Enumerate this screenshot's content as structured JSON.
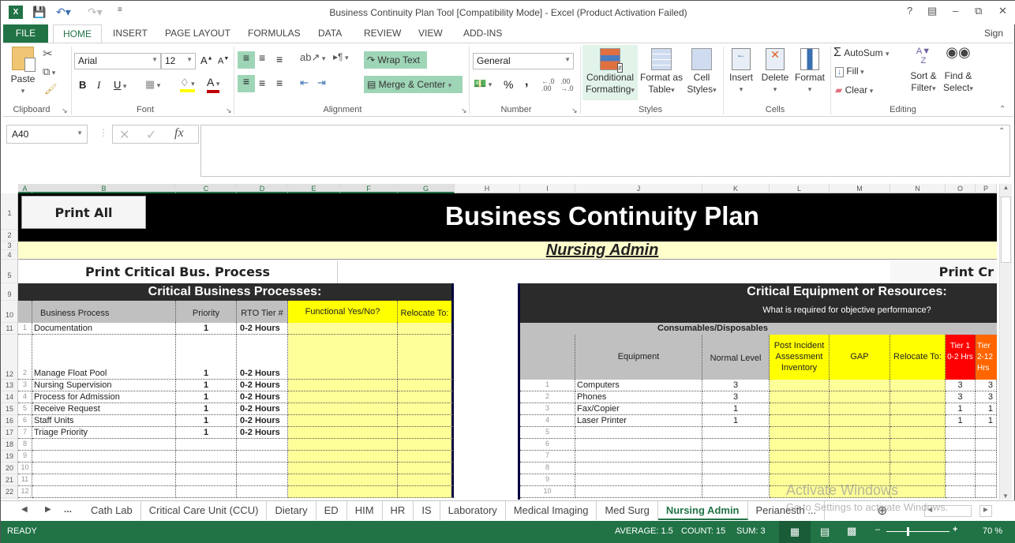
{
  "window": {
    "title": "Business Continuity Plan Tool  [Compatibility Mode] - Excel (Product Activation Failed)",
    "controls": [
      "?",
      "ribbon-display",
      "minimize",
      "restore",
      "close"
    ]
  },
  "ribbon_tabs": [
    "FILE",
    "HOME",
    "INSERT",
    "PAGE LAYOUT",
    "FORMULAS",
    "DATA",
    "REVIEW",
    "VIEW",
    "ADD-INS"
  ],
  "active_ribbon_tab": "HOME",
  "sign_in": "Sign in",
  "ribbon": {
    "clipboard": {
      "label": "Clipboard",
      "paste": "Paste"
    },
    "font": {
      "label": "Font",
      "family": "Arial",
      "size": "12",
      "bold": "B",
      "italic": "I",
      "underline": "U"
    },
    "alignment": {
      "label": "Alignment",
      "wrap_text": "Wrap Text",
      "merge_center": "Merge & Center"
    },
    "number": {
      "label": "Number",
      "format": "General",
      "percent": "%",
      "comma": ","
    },
    "styles": {
      "label": "Styles",
      "conditional_formatting": [
        "Conditional",
        "Formatting"
      ],
      "format_as_table": [
        "Format as",
        "Table"
      ],
      "cell_styles": [
        "Cell",
        "Styles"
      ]
    },
    "cells": {
      "label": "Cells",
      "insert": "Insert",
      "delete": "Delete",
      "format": "Format"
    },
    "editing": {
      "label": "Editing",
      "autosum": "AutoSum",
      "fill": "Fill",
      "clear": "Clear",
      "sort_filter": [
        "Sort &",
        "Filter"
      ],
      "find_select": [
        "Find &",
        "Select"
      ]
    }
  },
  "formula_bar": {
    "name_box": "A40",
    "formula": "",
    "fx": "fx"
  },
  "columns": [
    "A",
    "B",
    "C",
    "D",
    "E",
    "F",
    "G",
    "H",
    "I",
    "J",
    "K",
    "L",
    "M",
    "N",
    "O",
    "P"
  ],
  "rows": [
    "1",
    "2",
    "3",
    "4",
    "5",
    "9",
    "10",
    "11",
    "12",
    "13",
    "14",
    "15",
    "16",
    "17",
    "18",
    "19",
    "20",
    "21",
    "22"
  ],
  "sheet": {
    "print_all": "Print All",
    "title": "Business Continuity Plan",
    "department": "Nursing Admin",
    "print_critical": "Print Critical Bus. Process",
    "print_cr_partial": "Print Cr",
    "processes": {
      "heading": "Critical Business Processes:",
      "headers": [
        "Business Process",
        "Priority",
        "RTO Tier #",
        "Functional Yes/No?",
        "Relocate To:"
      ],
      "rows": [
        {
          "n": "1",
          "process": "Documentation",
          "priority": "1",
          "rto": "0-2 Hours"
        },
        {
          "n": "2",
          "process": "Manage Float Pool",
          "priority": "1",
          "rto": "0-2 Hours"
        },
        {
          "n": "3",
          "process": "Nursing Supervision",
          "priority": "1",
          "rto": "0-2 Hours"
        },
        {
          "n": "4",
          "process": "Process for Admission",
          "priority": "1",
          "rto": "0-2 Hours"
        },
        {
          "n": "5",
          "process": "Receive Request",
          "priority": "1",
          "rto": "0-2 Hours"
        },
        {
          "n": "6",
          "process": "Staff Units",
          "priority": "1",
          "rto": "0-2 Hours"
        },
        {
          "n": "7",
          "process": "Triage Priority",
          "priority": "1",
          "rto": "0-2 Hours"
        },
        {
          "n": "8",
          "process": "",
          "priority": "",
          "rto": ""
        },
        {
          "n": "9",
          "process": "",
          "priority": "",
          "rto": ""
        },
        {
          "n": "10",
          "process": "",
          "priority": "",
          "rto": ""
        },
        {
          "n": "11",
          "process": "",
          "priority": "",
          "rto": ""
        },
        {
          "n": "12",
          "process": "",
          "priority": "",
          "rto": ""
        }
      ]
    },
    "equipment": {
      "heading": "Critical Equipment or Resources:",
      "subheading": "What is required for objective performance?",
      "section": "Consumables/Disposables",
      "headers": [
        "Equipment",
        "Normal Level",
        "Post Incident Assessment Inventory",
        "GAP",
        "Relocate To:",
        "Tier 1 0-2 Hrs",
        "Tier 2-12 Hrs"
      ],
      "rows": [
        {
          "n": "1",
          "item": "Computers",
          "normal": "3",
          "t1": "3",
          "t2": "3"
        },
        {
          "n": "2",
          "item": "Phones",
          "normal": "3",
          "t1": "3",
          "t2": "3"
        },
        {
          "n": "3",
          "item": "Fax/Copier",
          "normal": "1",
          "t1": "1",
          "t2": "1"
        },
        {
          "n": "4",
          "item": "Laser Printer",
          "normal": "1",
          "t1": "1",
          "t2": "1"
        },
        {
          "n": "5",
          "item": "",
          "normal": "",
          "t1": "",
          "t2": ""
        },
        {
          "n": "6",
          "item": "",
          "normal": "",
          "t1": "",
          "t2": ""
        },
        {
          "n": "7",
          "item": "",
          "normal": "",
          "t1": "",
          "t2": ""
        },
        {
          "n": "8",
          "item": "",
          "normal": "",
          "t1": "",
          "t2": ""
        },
        {
          "n": "9",
          "item": "",
          "normal": "",
          "t1": "",
          "t2": ""
        },
        {
          "n": "10",
          "item": "",
          "normal": "",
          "t1": "",
          "t2": ""
        }
      ]
    }
  },
  "sheet_tabs": [
    "Cath Lab",
    "Critical Care Unit (CCU)",
    "Dietary",
    "ED",
    "HIM",
    "HR",
    "IS",
    "Laboratory",
    "Medical Imaging",
    "Med Surg",
    "Nursing Admin",
    "Perianesth ..."
  ],
  "active_sheet": "Nursing Admin",
  "watermark": {
    "line1": "Activate Windows",
    "line2": "Go to Settings to activate Windows."
  },
  "status_bar": {
    "mode": "READY",
    "average": "AVERAGE: 1.5",
    "count": "COUNT: 15",
    "sum": "SUM: 3",
    "zoom": "70 %"
  },
  "colors": {
    "excel_green": "#217346",
    "yellow": "#ffff00",
    "light_yellow": "#ffff99",
    "tier1_red": "#ff0000",
    "tier2_orange": "#ff6600"
  }
}
